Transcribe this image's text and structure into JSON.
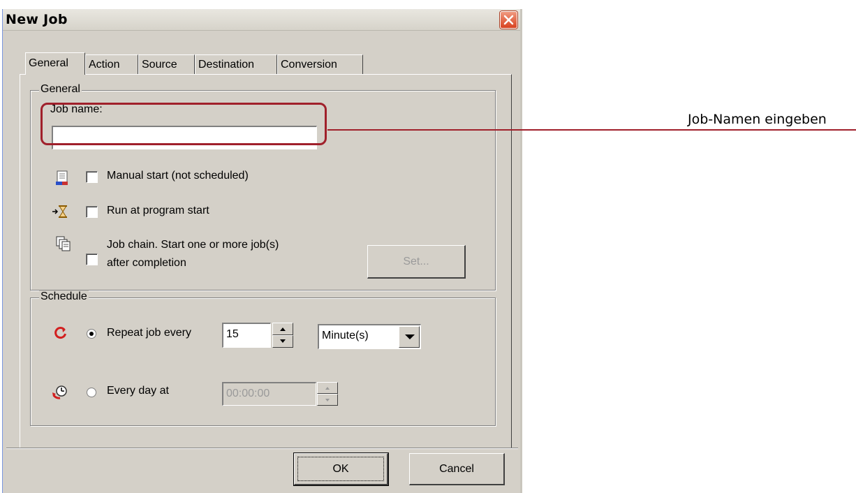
{
  "window": {
    "title": "New Job"
  },
  "tabs": [
    "General",
    "Action",
    "Source",
    "Destination",
    "Conversion"
  ],
  "general": {
    "group_label": "General",
    "job_name_label": "Job name:",
    "job_name_value": "",
    "manual_start_label": "Manual start (not scheduled)",
    "run_at_start_label": "Run at program start",
    "job_chain_line1": "Job chain. Start one or more job(s)",
    "job_chain_line2": "after completion",
    "set_button": "Set..."
  },
  "schedule": {
    "group_label": "Schedule",
    "repeat_label": "Repeat job every",
    "repeat_value": "15",
    "unit_value": "Minute(s)",
    "every_day_label": "Every day at",
    "time_value": "00:00:00",
    "repeat_selected": true
  },
  "buttons": {
    "ok": "OK",
    "cancel": "Cancel"
  },
  "annotation": {
    "label": "Job-Namen eingeben",
    "color": "#a0202b"
  },
  "colors": {
    "dialog_bg": "#d4d0c8",
    "close_red": "#d8411f"
  }
}
